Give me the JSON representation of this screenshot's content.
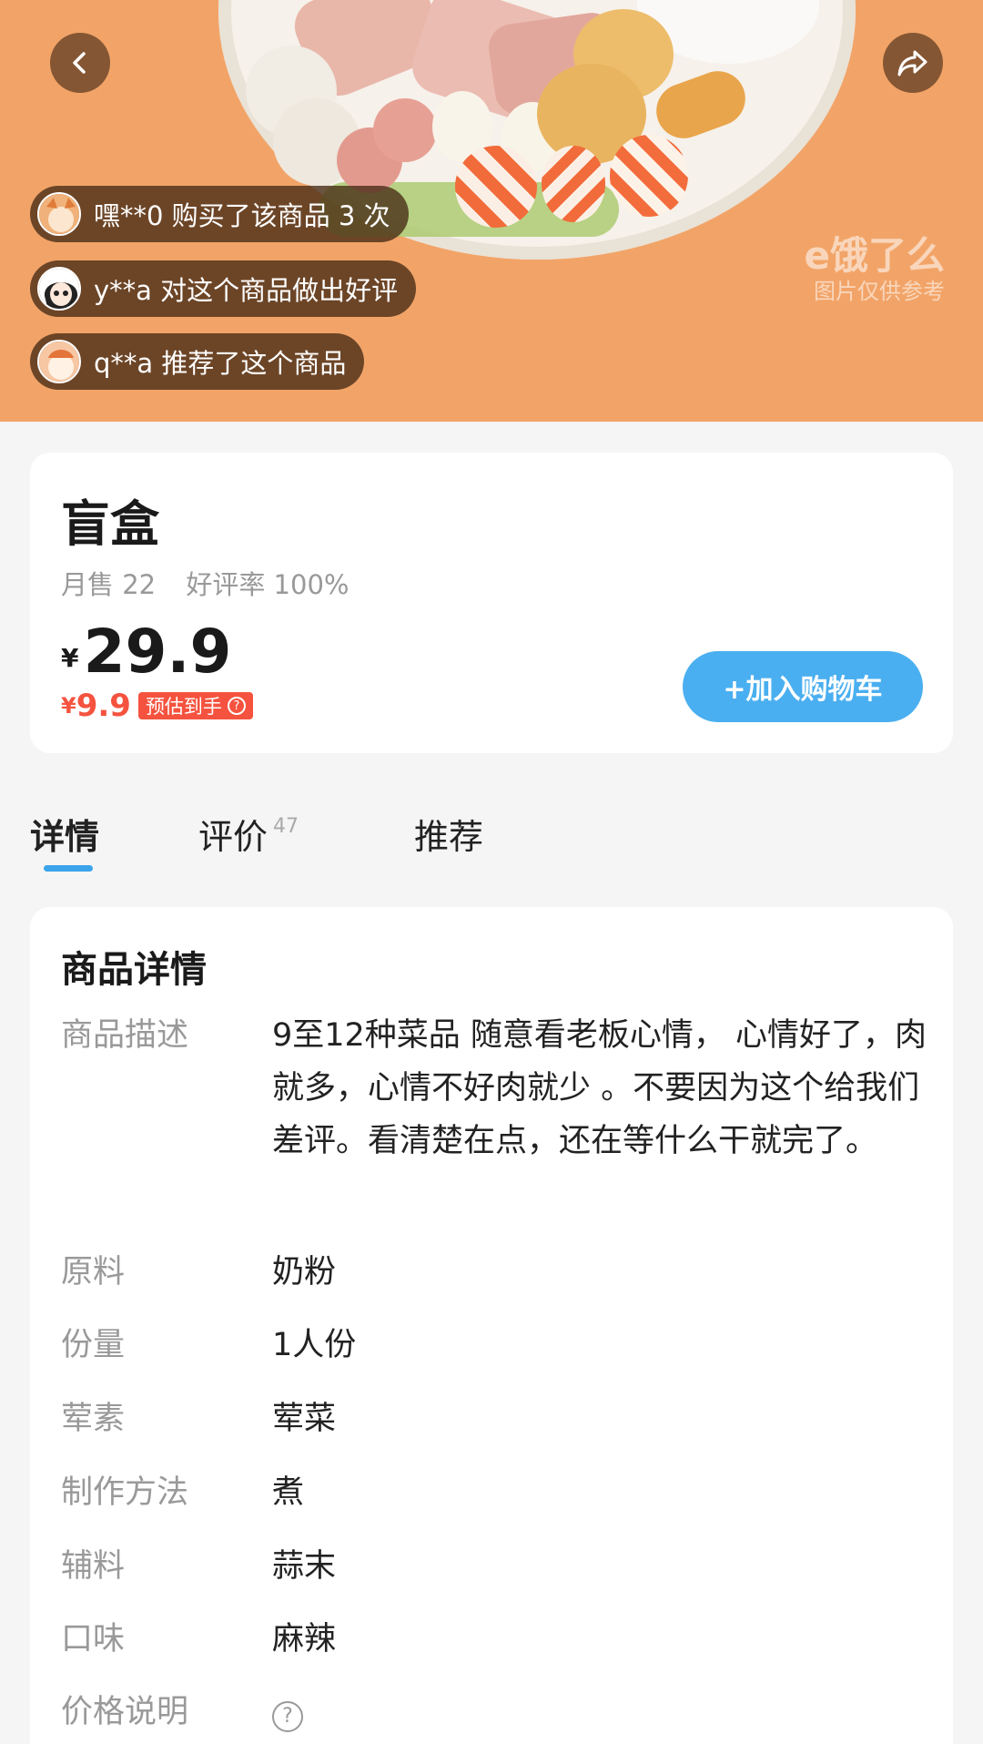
{
  "hero": {
    "watermark_logo": "e饿了么",
    "watermark_note": "图片仅供参考",
    "activity": [
      "嘿**0 购买了该商品 3 次",
      "y**a 对这个商品做出好评",
      "q**a 推荐了这个商品"
    ]
  },
  "product": {
    "name": "盲盒",
    "monthly_sales": "月售 22",
    "rating": "好评率 100%",
    "currency": "¥",
    "price": "29.9",
    "est_price": "9.9",
    "est_label": "预估到手",
    "add_to_cart": "+加入购物车"
  },
  "tabs": {
    "details": "详情",
    "reviews": "评价",
    "reviews_count": "47",
    "recommend": "推荐"
  },
  "details": {
    "title": "商品详情",
    "rows": [
      {
        "label": "商品描述",
        "value": "9至12种菜品 随意看老板心情， 心情好了，肉就多，心情不好肉就少 。不要因为这个给我们差评。看清楚在点，还在等什么干就完了。"
      },
      {
        "label": "原料",
        "value": "奶粉"
      },
      {
        "label": "份量",
        "value": "1人份"
      },
      {
        "label": "荤素",
        "value": " 荤菜"
      },
      {
        "label": "制作方法",
        "value": " 煮"
      },
      {
        "label": "辅料",
        "value": " 蒜末"
      },
      {
        "label": "口味",
        "value": " 麻辣"
      },
      {
        "label": "价格说明",
        "value": ""
      }
    ]
  },
  "colors": {
    "hero_bg": "#f2a468",
    "accent_blue": "#4aaff0",
    "price_red": "#f5533f"
  }
}
